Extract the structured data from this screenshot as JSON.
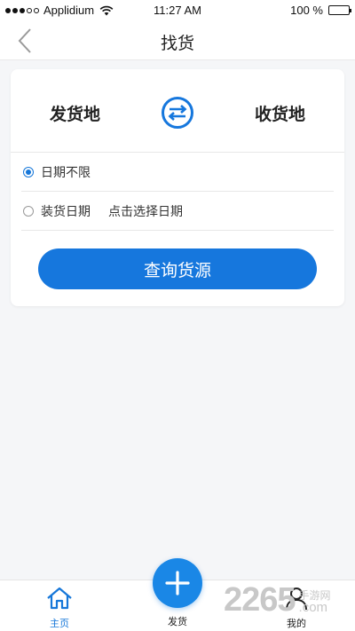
{
  "status_bar": {
    "carrier": "Applidium",
    "time": "11:27 AM",
    "battery": "100 %",
    "battery_level": 1.0
  },
  "nav": {
    "title": "找货",
    "back_icon": "chevron-left-icon"
  },
  "route": {
    "origin": "发货地",
    "destination": "收货地",
    "swap_icon": "swap-arrows-icon"
  },
  "date_options": [
    {
      "label": "日期不限",
      "selected": true
    },
    {
      "label": "装货日期",
      "hint": "点击选择日期",
      "selected": false
    }
  ],
  "query_button": "查询货源",
  "tabs": {
    "home": {
      "label": "主页",
      "icon": "home-icon"
    },
    "publish": {
      "label": "发货",
      "icon": "plus-icon"
    },
    "mine": {
      "label": "我的",
      "icon": "user-icon"
    }
  },
  "watermark": {
    "number": "2265",
    "cn": "手游网",
    "en": ".com"
  },
  "colors": {
    "accent": "#1677dd",
    "background": "#f5f6f8"
  }
}
